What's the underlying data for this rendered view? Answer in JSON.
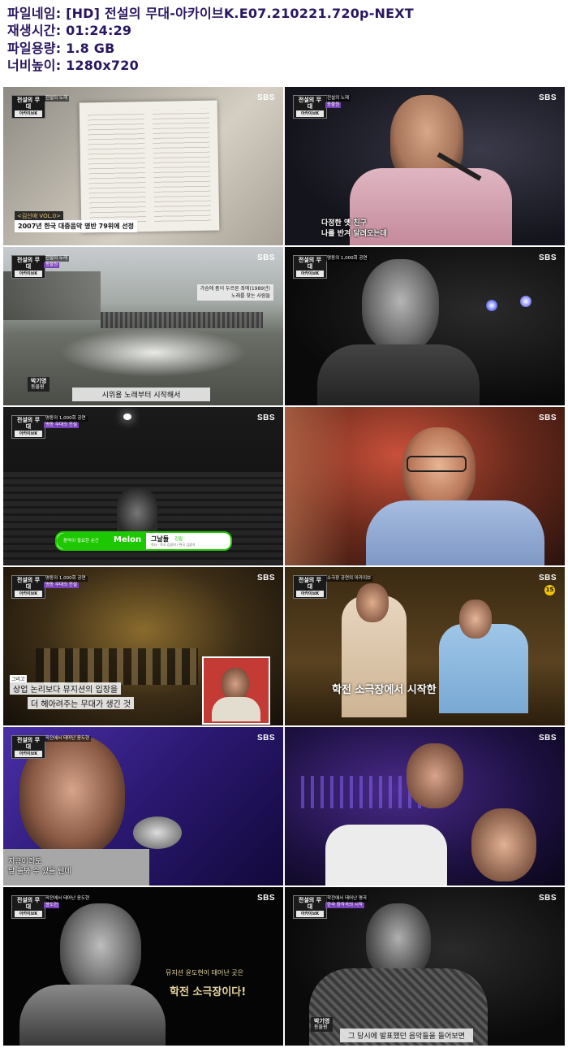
{
  "info": {
    "filename_label": "파일네임",
    "filename": "[HD] 전설의 무대-아카이브K.E07.210221.720p-NEXT",
    "runtime_label": "재생시간",
    "runtime": "01:24:29",
    "filesize_label": "파일용량",
    "filesize": "1.8 GB",
    "resolution_label": "너비높이",
    "resolution": "1280x720"
  },
  "broadcaster": "SBS",
  "frames": [
    {
      "id": 1,
      "caption": "2007년 한국 대중음악 명반 79위에 선정",
      "badge": "<김산애 VOL.0>"
    },
    {
      "id": 2,
      "caption_lines": [
        "다정한 옛 친구",
        "나를 반겨 달려오는데"
      ]
    },
    {
      "id": 3,
      "caption": "시위용 노래부터 시작해서",
      "name": "박기영",
      "side_lines": [
        "가슴에 품어 두르른 좌에(1989년)",
        "노래를 찾는 사람들"
      ]
    },
    {
      "id": 4
    },
    {
      "id": 5,
      "melon_text": "음악이 필요한 순간",
      "melon_brand": "Melon",
      "song": "그날들",
      "artist": "김필",
      "credits": "작사 · 작곡 김광석 / 편곡 김광석"
    },
    {
      "id": 6
    },
    {
      "id": 7,
      "lines": [
        "그리고",
        "상업 논리보다 뮤지션의 입장을",
        "더 헤아려주는 무대가 생긴 것"
      ]
    },
    {
      "id": 8,
      "caption": "학전 소극장에서 시작한",
      "rating": "15"
    },
    {
      "id": 9,
      "caption_lines": [
        "지금이라도",
        "날 돌봐 수 있을 텐데"
      ]
    },
    {
      "id": 10
    },
    {
      "id": 11,
      "caption_lines": [
        "뮤지션 윤도현이 태어난 곳은",
        "학전 소극장이다!"
      ]
    },
    {
      "id": 12,
      "caption": "그 당시에 발표했던 음악들을 들어보면",
      "name": "박기영"
    }
  ],
  "program_logo": "전설의 무대",
  "program_logo_sub": "아카이브K"
}
